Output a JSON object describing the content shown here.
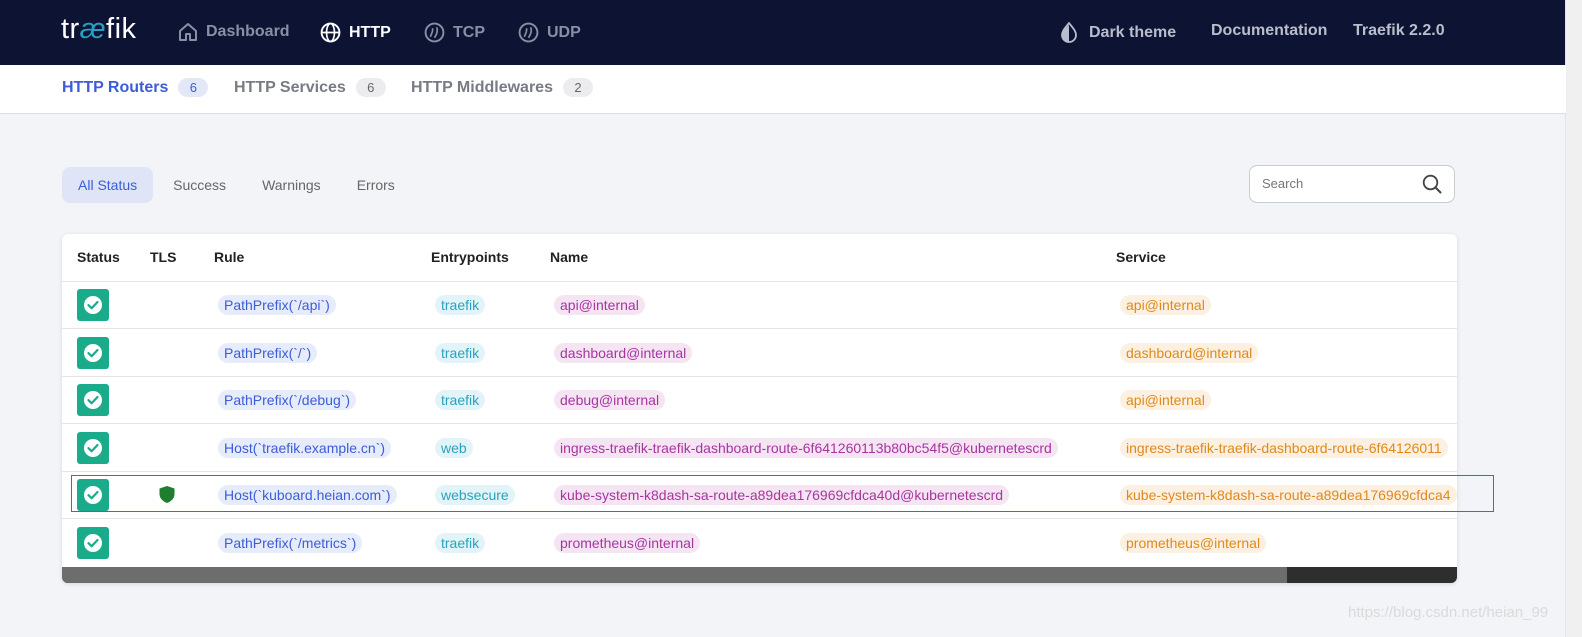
{
  "topbar": {
    "logo_pre": "tr",
    "logo_ae": "æ",
    "logo_post": "fik",
    "nav": [
      {
        "label": "Dashboard",
        "icon": "home-icon",
        "active": false
      },
      {
        "label": "HTTP",
        "icon": "globe-icon",
        "active": true
      },
      {
        "label": "TCP",
        "icon": "tcp-icon",
        "active": false
      },
      {
        "label": "UDP",
        "icon": "udp-icon",
        "active": false
      }
    ],
    "dark_theme": "Dark theme",
    "documentation": "Documentation",
    "version": "Traefik 2.2.0"
  },
  "subnav": [
    {
      "label": "HTTP Routers",
      "count": "6",
      "active": true
    },
    {
      "label": "HTTP Services",
      "count": "6",
      "active": false
    },
    {
      "label": "HTTP Middlewares",
      "count": "2",
      "active": false
    }
  ],
  "filters": [
    "All Status",
    "Success",
    "Warnings",
    "Errors"
  ],
  "search": {
    "placeholder": "Search"
  },
  "table": {
    "headers": [
      "Status",
      "TLS",
      "Rule",
      "Entrypoints",
      "Name",
      "Service"
    ],
    "rows": [
      {
        "status": "success",
        "tls": false,
        "rule": "PathPrefix(`/api`)",
        "entrypoints": "traefik",
        "name": "api@internal",
        "service": "api@internal"
      },
      {
        "status": "success",
        "tls": false,
        "rule": "PathPrefix(`/`)",
        "entrypoints": "traefik",
        "name": "dashboard@internal",
        "service": "dashboard@internal"
      },
      {
        "status": "success",
        "tls": false,
        "rule": "PathPrefix(`/debug`)",
        "entrypoints": "traefik",
        "name": "debug@internal",
        "service": "api@internal"
      },
      {
        "status": "success",
        "tls": false,
        "rule": "Host(`traefik.example.cn`)",
        "entrypoints": "web",
        "name": "ingress-traefik-traefik-dashboard-route-6f641260113b80bc54f5@kubernetescrd",
        "service": "ingress-traefik-traefik-dashboard-route-6f64126011"
      },
      {
        "status": "success",
        "tls": true,
        "rule": "Host(`kuboard.heian.com`)",
        "entrypoints": "websecure",
        "name": "kube-system-k8dash-sa-route-a89dea176969cfdca40d@kubernetescrd",
        "service": "kube-system-k8dash-sa-route-a89dea176969cfdca4"
      },
      {
        "status": "success",
        "tls": false,
        "rule": "PathPrefix(`/metrics`)",
        "entrypoints": "traefik",
        "name": "prometheus@internal",
        "service": "prometheus@internal"
      }
    ]
  },
  "watermark": "https://blog.csdn.net/heian_99",
  "colors": {
    "topbar": "#0d1433",
    "accent": "#3c5cd9",
    "success": "#1aab8b",
    "tls": "#1e7d2e"
  }
}
